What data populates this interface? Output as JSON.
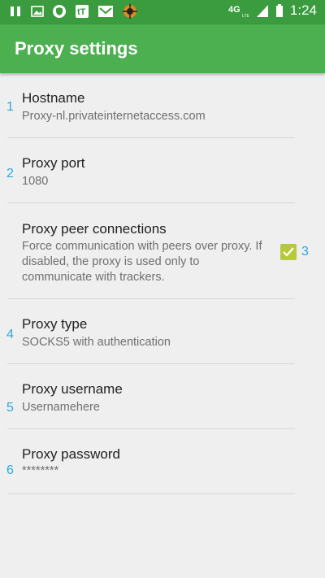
{
  "status_bar": {
    "time": "1:24",
    "network": "4G LTE",
    "icons": [
      "pause-icon",
      "image-icon",
      "shield-icon",
      "tt-icon",
      "mail-icon",
      "crosshair-icon",
      "signal-icon",
      "battery-icon"
    ]
  },
  "appbar": {
    "title": "Proxy settings"
  },
  "settings": [
    {
      "index": "1",
      "title": "Hostname",
      "summary": "Proxy-nl.privateinternetaccess.com"
    },
    {
      "index": "2",
      "title": "Proxy port",
      "summary": "1080"
    },
    {
      "index": "3",
      "title": "Proxy peer connections",
      "summary": "Force communication with peers over proxy. If disabled, the proxy is used only to communicate with trackers.",
      "checked": true
    },
    {
      "index": "4",
      "title": "Proxy type",
      "summary": "SOCKS5 with authentication"
    },
    {
      "index": "5",
      "title": "Proxy username",
      "summary": "Usernamehere"
    },
    {
      "index": "6",
      "title": "Proxy password",
      "summary": "********"
    }
  ],
  "colors": {
    "statusbar": "#3a9b3f",
    "appbar": "#4caf50",
    "accent": "#b6c93b",
    "annotation": "#29a8e0"
  }
}
